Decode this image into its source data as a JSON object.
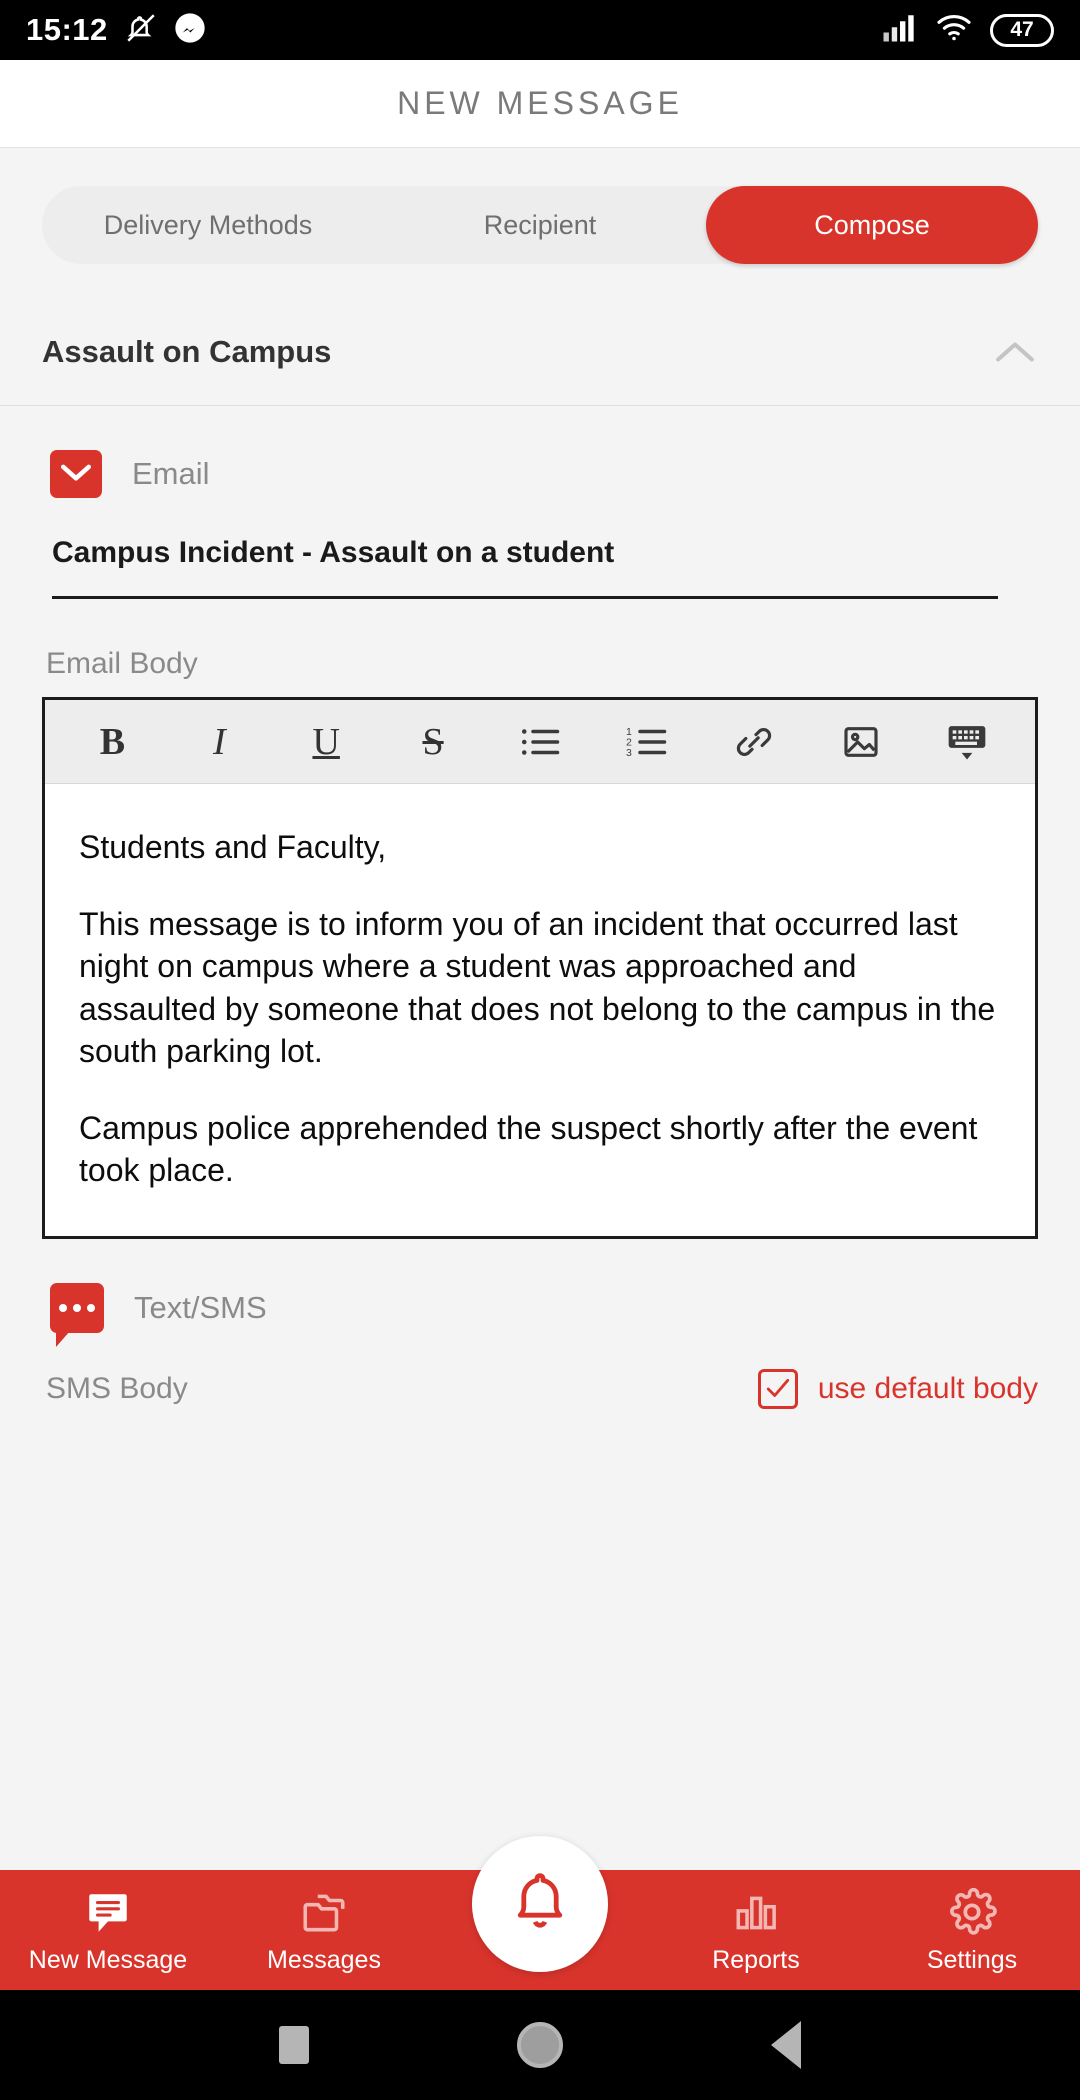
{
  "status_bar": {
    "time": "15:12",
    "icons": [
      "bell-muted-icon",
      "messenger-icon",
      "signal-icon",
      "wifi-icon"
    ],
    "battery_level": "47"
  },
  "app_bar": {
    "title": "NEW MESSAGE"
  },
  "tabs": {
    "items": [
      {
        "label": "Delivery Methods",
        "active": false
      },
      {
        "label": "Recipient",
        "active": false
      },
      {
        "label": "Compose",
        "active": true
      }
    ]
  },
  "section": {
    "title": "Assault on Campus",
    "collapse_icon": "chevron-up-icon"
  },
  "email": {
    "channel_label": "Email",
    "channel_icon": "email-icon",
    "subject_value": "Campus Incident - Assault on a student",
    "body_label": "Email Body",
    "toolbar": [
      {
        "name": "bold-icon",
        "label": "B"
      },
      {
        "name": "italic-icon",
        "label": "I"
      },
      {
        "name": "underline-icon",
        "label": "U"
      },
      {
        "name": "strikethrough-icon",
        "label": "S"
      },
      {
        "name": "bullet-list-icon",
        "label": ""
      },
      {
        "name": "numbered-list-icon",
        "label": ""
      },
      {
        "name": "link-icon",
        "label": ""
      },
      {
        "name": "image-icon",
        "label": ""
      },
      {
        "name": "keyboard-hide-icon",
        "label": ""
      }
    ],
    "body_paragraphs": [
      "Students and Faculty,",
      "This message is to inform you of an incident that occurred last night on campus where a student was approached and assaulted by someone that does not belong to the campus in the south parking lot.",
      "Campus police apprehended the suspect shortly after the event took place."
    ]
  },
  "sms": {
    "channel_label": "Text/SMS",
    "channel_icon": "sms-icon",
    "body_label": "SMS Body",
    "default_body_label": "use default body",
    "default_body_checked": true
  },
  "bottom_nav": {
    "items": [
      {
        "label": "New Message",
        "icon": "new-message-icon"
      },
      {
        "label": "Messages",
        "icon": "messages-folder-icon"
      },
      {
        "label": "Reports",
        "icon": "reports-bar-chart-icon"
      },
      {
        "label": "Settings",
        "icon": "settings-gear-icon"
      }
    ],
    "fab_icon": "bell-icon"
  },
  "android_nav": {
    "recents": "square-recents-icon",
    "home": "circle-home-icon",
    "back": "triangle-back-icon"
  },
  "colors": {
    "brand_red": "#d9342c",
    "page_bg": "#f4f4f4",
    "muted_text": "#8a8a8a"
  }
}
